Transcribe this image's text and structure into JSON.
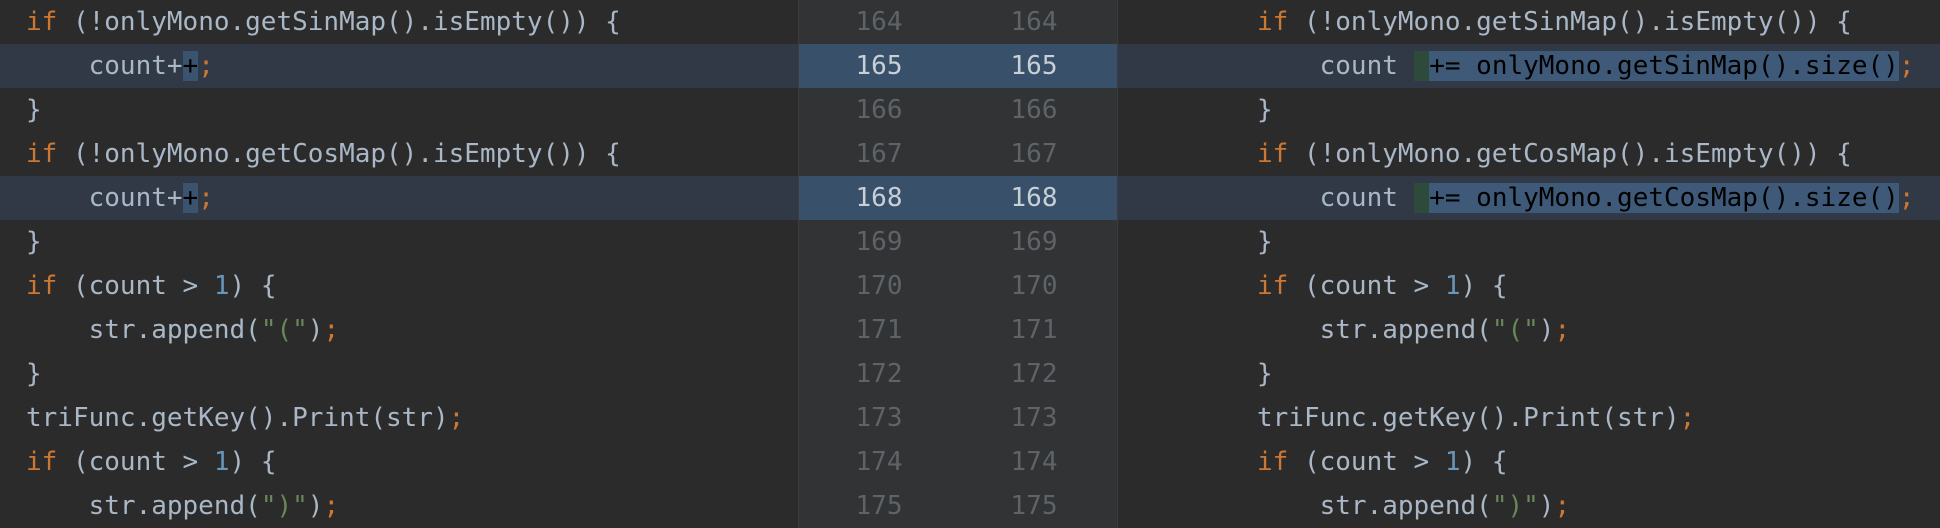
{
  "colors": {
    "background": "#2b2b2b",
    "changed_row": "#303945",
    "keyword": "#cc7832",
    "number": "#6897bb",
    "string": "#6a8759",
    "text": "#a9b7c6"
  },
  "rows": [
    {
      "left_num": "164",
      "right_num": "164",
      "changed": false,
      "left": [
        [
          "kw",
          "if"
        ],
        [
          "plain",
          " (!onlyMono.getSinMap().isEmpty()) {"
        ]
      ],
      "right": [
        [
          "kw",
          "if"
        ],
        [
          "plain",
          " (!onlyMono.getSinMap().isEmpty()) {"
        ]
      ]
    },
    {
      "left_num": "165",
      "right_num": "165",
      "changed": true,
      "left": [
        [
          "plain",
          "    count+"
        ],
        [
          "hl",
          "+"
        ],
        [
          "punct",
          ";"
        ]
      ],
      "right": [
        [
          "plain",
          "    count "
        ],
        [
          "hl-add",
          " "
        ],
        [
          "hl-mod",
          "+= onlyMono.getSinMap().size("
        ],
        [
          "hl-mod",
          ")"
        ],
        [
          "punct",
          ";"
        ]
      ]
    },
    {
      "left_num": "166",
      "right_num": "166",
      "changed": false,
      "left": [
        [
          "plain",
          "}"
        ]
      ],
      "right": [
        [
          "plain",
          "}"
        ]
      ]
    },
    {
      "left_num": "167",
      "right_num": "167",
      "changed": false,
      "left": [
        [
          "kw",
          "if"
        ],
        [
          "plain",
          " (!onlyMono.getCosMap().isEmpty()) {"
        ]
      ],
      "right": [
        [
          "kw",
          "if"
        ],
        [
          "plain",
          " (!onlyMono.getCosMap().isEmpty()) {"
        ]
      ]
    },
    {
      "left_num": "168",
      "right_num": "168",
      "changed": true,
      "left": [
        [
          "plain",
          "    count+"
        ],
        [
          "hl",
          "+"
        ],
        [
          "punct",
          ";"
        ]
      ],
      "right": [
        [
          "plain",
          "    count "
        ],
        [
          "hl-add",
          " "
        ],
        [
          "hl-mod",
          "+= onlyMono.getCosMap().size("
        ],
        [
          "hl-mod",
          ")"
        ],
        [
          "punct",
          ";"
        ]
      ]
    },
    {
      "left_num": "169",
      "right_num": "169",
      "changed": false,
      "left": [
        [
          "plain",
          "}"
        ]
      ],
      "right": [
        [
          "plain",
          "}"
        ]
      ]
    },
    {
      "left_num": "170",
      "right_num": "170",
      "changed": false,
      "left": [
        [
          "kw",
          "if"
        ],
        [
          "plain",
          " (count > "
        ],
        [
          "num",
          "1"
        ],
        [
          "plain",
          ") {"
        ]
      ],
      "right": [
        [
          "kw",
          "if"
        ],
        [
          "plain",
          " (count > "
        ],
        [
          "num",
          "1"
        ],
        [
          "plain",
          ") {"
        ]
      ]
    },
    {
      "left_num": "171",
      "right_num": "171",
      "changed": false,
      "left": [
        [
          "plain",
          "    str.append("
        ],
        [
          "str",
          "\"(\""
        ],
        [
          "plain",
          ")"
        ],
        [
          "punct",
          ";"
        ]
      ],
      "right": [
        [
          "plain",
          "    str.append("
        ],
        [
          "str",
          "\"(\""
        ],
        [
          "plain",
          ")"
        ],
        [
          "punct",
          ";"
        ]
      ]
    },
    {
      "left_num": "172",
      "right_num": "172",
      "changed": false,
      "left": [
        [
          "plain",
          "}"
        ]
      ],
      "right": [
        [
          "plain",
          "}"
        ]
      ]
    },
    {
      "left_num": "173",
      "right_num": "173",
      "changed": false,
      "left": [
        [
          "plain",
          "triFunc.getKey().Print(str)"
        ],
        [
          "punct",
          ";"
        ]
      ],
      "right": [
        [
          "plain",
          "triFunc.getKey().Print(str)"
        ],
        [
          "punct",
          ";"
        ]
      ]
    },
    {
      "left_num": "174",
      "right_num": "174",
      "changed": false,
      "left": [
        [
          "kw",
          "if"
        ],
        [
          "plain",
          " (count > "
        ],
        [
          "num",
          "1"
        ],
        [
          "plain",
          ") {"
        ]
      ],
      "right": [
        [
          "kw",
          "if"
        ],
        [
          "plain",
          " (count > "
        ],
        [
          "num",
          "1"
        ],
        [
          "plain",
          ") {"
        ]
      ]
    },
    {
      "left_num": "175",
      "right_num": "175",
      "changed": false,
      "left": [
        [
          "plain",
          "    str.append("
        ],
        [
          "str",
          "\")\""
        ],
        [
          "plain",
          ")"
        ],
        [
          "punct",
          ";"
        ]
      ],
      "right": [
        [
          "plain",
          "    str.append("
        ],
        [
          "str",
          "\")\""
        ],
        [
          "plain",
          ")"
        ],
        [
          "punct",
          ";"
        ]
      ]
    }
  ]
}
